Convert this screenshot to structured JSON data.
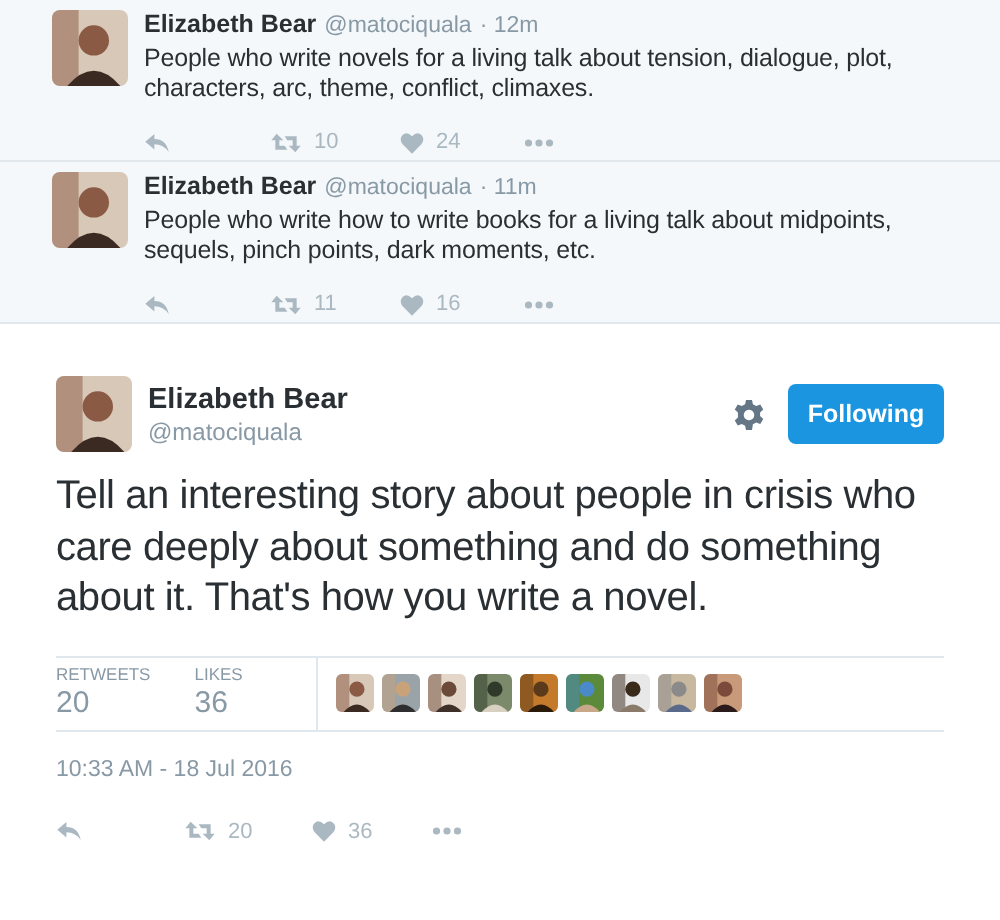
{
  "conversation": [
    {
      "author": "Elizabeth Bear",
      "handle": "@matociquala",
      "time": "· 12m",
      "text": "People who write novels for a living talk about tension, dialogue, plot, characters, arc, theme, conflict, climaxes.",
      "retweets": "10",
      "likes": "24"
    },
    {
      "author": "Elizabeth Bear",
      "handle": "@matociquala",
      "time": "· 11m",
      "text": "People who write how to write books for a living talk about midpoints, sequels, pinch points, dark moments, etc.",
      "retweets": "11",
      "likes": "16"
    }
  ],
  "main_tweet": {
    "author": "Elizabeth Bear",
    "handle": "@matociquala",
    "follow_button": "Following",
    "text": "Tell an interesting story about people in crisis who care deeply about something and do something about it. That's how you write a novel.",
    "stats": [
      {
        "label": "RETWEETS",
        "value": "20"
      },
      {
        "label": "LIKES",
        "value": "36"
      }
    ],
    "timestamp": "10:33 AM - 18 Jul 2016",
    "retweets": "20",
    "likes": "36"
  }
}
